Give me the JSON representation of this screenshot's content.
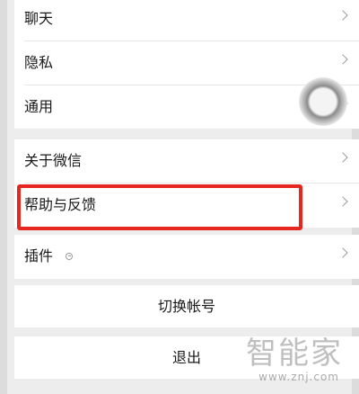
{
  "group1": {
    "items": [
      {
        "label": "聊天"
      },
      {
        "label": "隐私"
      },
      {
        "label": "通用"
      }
    ]
  },
  "group2": {
    "items": [
      {
        "label": "关于微信"
      },
      {
        "label": "帮助与反馈"
      }
    ]
  },
  "group3": {
    "items": [
      {
        "label": "插件"
      }
    ]
  },
  "switch_account": {
    "label": "切换帐号"
  },
  "logout": {
    "label": "退出"
  },
  "watermark": {
    "name": "智能家",
    "url": "www.znj.com"
  },
  "colors": {
    "highlight": "#e5271f",
    "background": "#ededed"
  }
}
